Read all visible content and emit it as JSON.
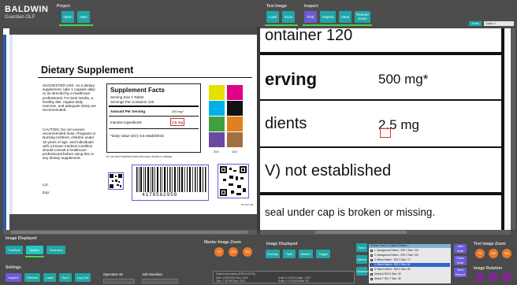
{
  "app": {
    "brand": "BALDWIN",
    "brand_sub": "Guardian OLP"
  },
  "toolbar": {
    "project_title": "Project",
    "open_label": "Open",
    "new_label": "New",
    "test_image_title": "Test Image",
    "load_label": "Load",
    "scan_label": "Scan",
    "inspect_title": "Inspect",
    "find_label": "Find",
    "inspect_label": "Inspect",
    "save_label": "Save",
    "restore_label": "Restore Zoom",
    "zoom_label": "Zoom",
    "zoom_select": "Option 1"
  },
  "label_left": {
    "title": "Dietary Supplement",
    "suggested_use": "SUGGESTED USE: As a dietary supplement, take 1 capsule daily or as directed by a healthcare professional. For best results, a healthy diet, regular daily exercise, and adequate sleep are recommended.",
    "caution": "CAUTION: Do not exceed recommended dose. Pregnant or Nursing mothers, children under 18 years of age, and individuals with a known medical condition should consult a healthcare professional before using this or any dietary supplement.",
    "lot": "Lot:",
    "exp": "Exp:",
    "facts_title": "Supplement Facts",
    "serving_size": "Serving Size 1 Tablet",
    "servings_per": "Servings Per Container 120",
    "amount_head": "Amount Per Serving",
    "amount_val": "300 mg*",
    "inactive": "Inactive Ingredients",
    "inactive_val": "2.5 mg",
    "dv_note": "*Daily Value (DV) not established",
    "seal_note": "Do not use if imprinted seal under cap is broken or missing.",
    "code1": "204",
    "code2": "144",
    "barcode_number": "4178562958",
    "part_code": "P8 103 783"
  },
  "zoom_view": {
    "line1": "ontainer 120",
    "line2": "erving",
    "line2_val": "500 mg*",
    "line3": "dients",
    "line3_val": "2.5 mg",
    "line4": "V) not established",
    "line5": "seal under cap is broken or missing."
  },
  "bottom": {
    "image_displayed_title": "Image Displayed",
    "full_split": "Full/Split",
    "master": "Master",
    "overview": "Overview",
    "master_zoom_title": "Master Image Zoom",
    "zoom_fit": "Fit",
    "zoom_200": "200",
    "zoom_300": "300",
    "image_displayed_title2": "Image Displayed",
    "overlay": "Overlay",
    "split": "Split",
    "master2": "Master",
    "toggle": "Toggle",
    "btn_save": "Save",
    "btn_select": "Select",
    "btn_unselect": "Unselect",
    "list_header": "Defects Found  1    Critical Defects  1",
    "list_items": [
      "1. Background Defect - ROI 1 Size: 700",
      "2. Background Defect - ROI 2 Size: 512",
      "3. Bleed Defect - ROI 3 Size: 72",
      "4. Bleed Defect - ROI 4 Size: 64",
      "5. Bleed Defect - ROI 5 Size: 48",
      "Defect 6 ROI 6 Size: 40",
      "Defect 7 ROI 7 Size: 36"
    ],
    "adv_1": "Add Note",
    "adv_2": "Clear Note",
    "adv_3": "View Report",
    "test_zoom_title": "Test Image Zoom",
    "t_fit": "Fit",
    "t_200": "200",
    "t_300": "300",
    "image_rotation_title": "Image Rotation",
    "settings_title": "Settings",
    "s_inspect": "Inspect",
    "s_defects": "Defects",
    "s_load": "Load",
    "s_sync": "Sync",
    "s_logout": "Log Out",
    "operator_label": "Operator ID",
    "job_label": "Job Number",
    "info_title": "System Information  (REPLICATED)",
    "info_l1": "Date: 12/31/2024    Size: 1024",
    "info_l2": "Time: 7:18 PM    Size: 1200",
    "info_r1": "Scale X: 0.9115    Angle: -0.35 °",
    "info_r2": "Scale Y: 0.9136    Rotate: 0/0"
  }
}
